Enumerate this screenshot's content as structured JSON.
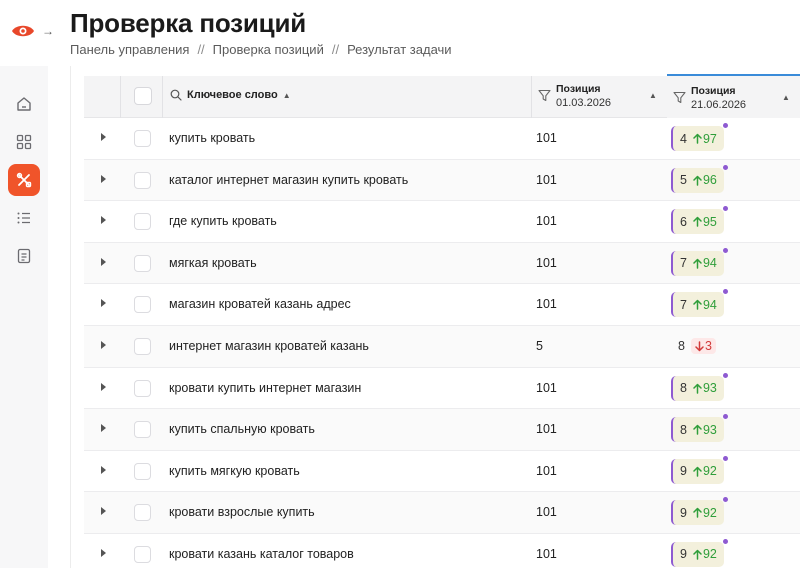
{
  "header": {
    "title": "Проверка позиций",
    "breadcrumb": [
      "Панель управления",
      "Проверка позиций",
      "Результат задачи"
    ],
    "breadcrumb_separator": "//"
  },
  "sidebar": {
    "items": [
      {
        "icon": "home-icon",
        "active": false
      },
      {
        "icon": "grid-icon",
        "active": false
      },
      {
        "icon": "tools-icon",
        "active": true
      },
      {
        "icon": "list-icon",
        "active": false
      },
      {
        "icon": "report-icon",
        "active": false
      }
    ],
    "accent": "#f0542a"
  },
  "table": {
    "columns": {
      "keyword": "Ключевое слово",
      "pos1_label": "Позиция",
      "pos1_date": "01.03.2026",
      "pos2_label": "Позиция",
      "pos2_date": "21.06.2026"
    },
    "rows": [
      {
        "keyword": "купить кровать",
        "pos1": "101",
        "pos2": "4",
        "delta": "97",
        "dir": "up"
      },
      {
        "keyword": "каталог интернет магазин купить кровать",
        "pos1": "101",
        "pos2": "5",
        "delta": "96",
        "dir": "up"
      },
      {
        "keyword": "где купить кровать",
        "pos1": "101",
        "pos2": "6",
        "delta": "95",
        "dir": "up"
      },
      {
        "keyword": "мягкая кровать",
        "pos1": "101",
        "pos2": "7",
        "delta": "94",
        "dir": "up"
      },
      {
        "keyword": "магазин кроватей казань адрес",
        "pos1": "101",
        "pos2": "7",
        "delta": "94",
        "dir": "up"
      },
      {
        "keyword": "интернет магазин кроватей казань",
        "pos1": "5",
        "pos2": "8",
        "delta": "3",
        "dir": "down"
      },
      {
        "keyword": "кровати купить интернет магазин",
        "pos1": "101",
        "pos2": "8",
        "delta": "93",
        "dir": "up"
      },
      {
        "keyword": "купить спальную кровать",
        "pos1": "101",
        "pos2": "8",
        "delta": "93",
        "dir": "up"
      },
      {
        "keyword": "купить мягкую кровать",
        "pos1": "101",
        "pos2": "9",
        "delta": "92",
        "dir": "up"
      },
      {
        "keyword": "кровати взрослые купить",
        "pos1": "101",
        "pos2": "9",
        "delta": "92",
        "dir": "up"
      },
      {
        "keyword": "кровати казань каталог товаров",
        "pos1": "101",
        "pos2": "9",
        "delta": "92",
        "dir": "up"
      }
    ]
  }
}
